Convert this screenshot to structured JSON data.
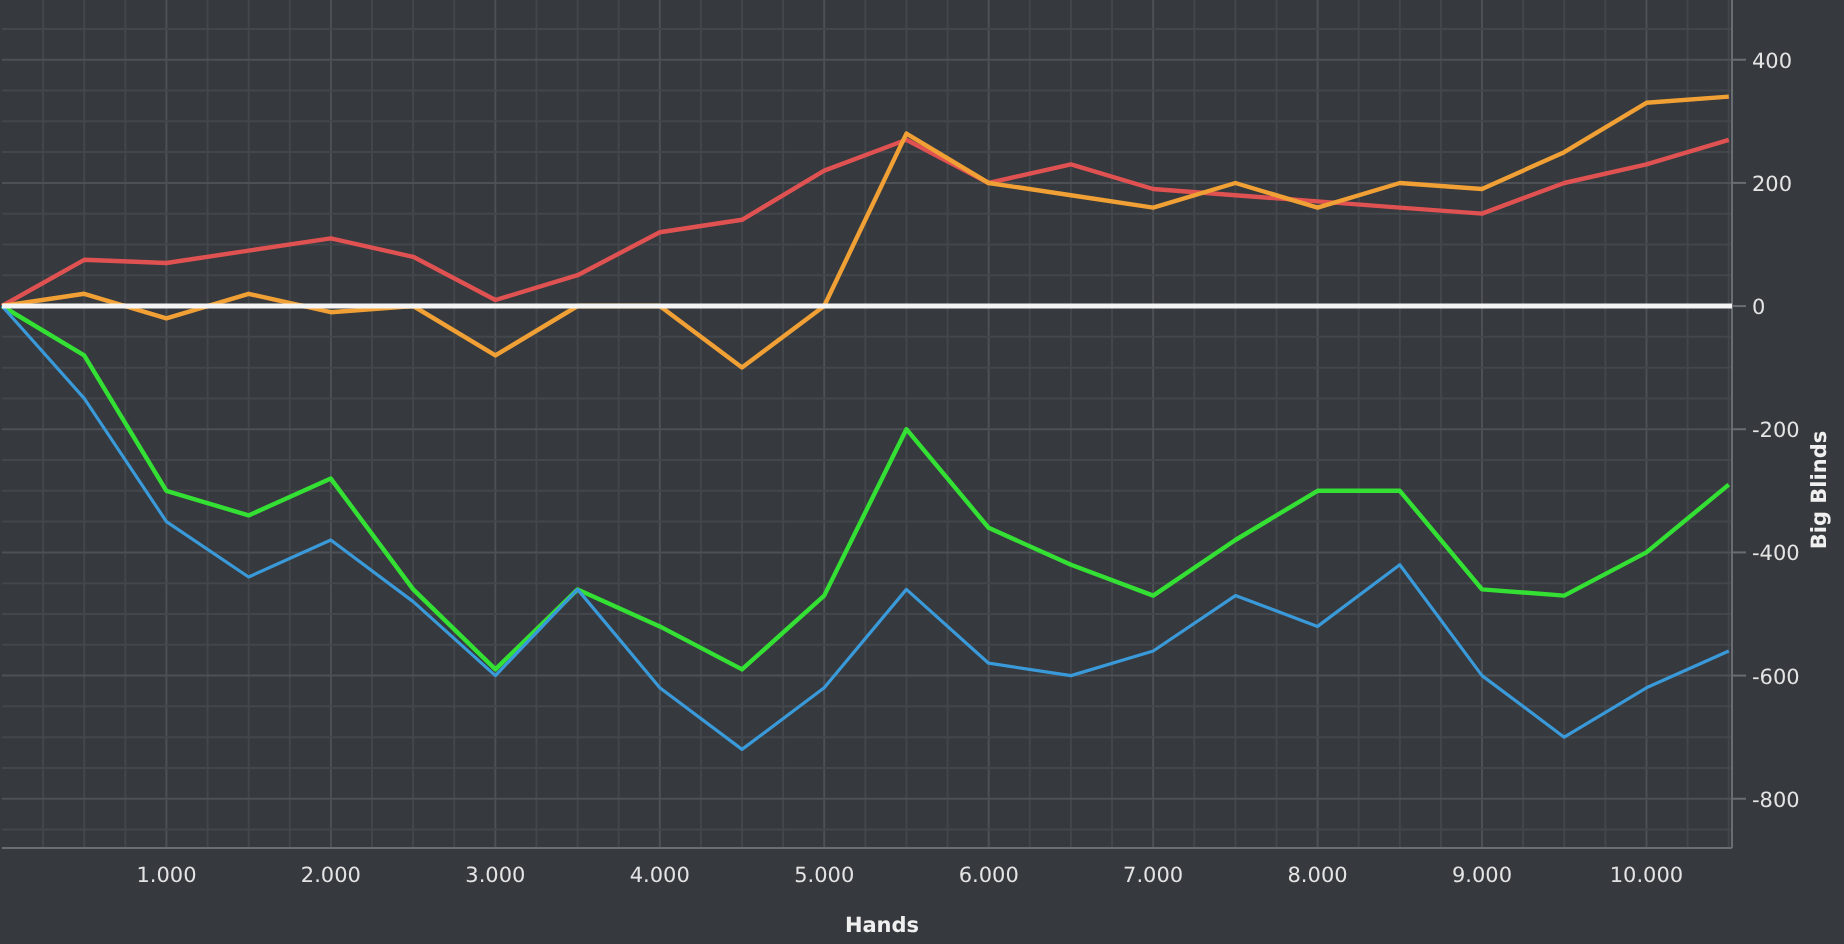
{
  "chart_data": {
    "type": "line",
    "grid": true,
    "xlabel": "Hands",
    "ylabel": "Big Blinds",
    "x": [
      0,
      500,
      1000,
      1500,
      2000,
      2500,
      3000,
      3500,
      4000,
      4500,
      5000,
      5500,
      6000,
      6500,
      7000,
      7500,
      8000,
      8500,
      9000,
      9500,
      10000,
      10500
    ],
    "series": [
      {
        "color": "#e05252",
        "values": [
          0,
          75,
          70,
          90,
          110,
          80,
          10,
          50,
          120,
          140,
          220,
          270,
          200,
          230,
          190,
          180,
          170,
          160,
          150,
          200,
          230,
          270
        ]
      },
      {
        "color": "#f0a035",
        "values": [
          0,
          20,
          -20,
          20,
          -10,
          0,
          -80,
          0,
          0,
          -100,
          0,
          280,
          200,
          180,
          160,
          200,
          160,
          200,
          190,
          250,
          330,
          340
        ]
      },
      {
        "color": "#33e033",
        "values": [
          0,
          -80,
          -300,
          -340,
          -280,
          -460,
          -590,
          -460,
          -520,
          -590,
          -470,
          -200,
          -360,
          -420,
          -470,
          -380,
          -300,
          -300,
          -460,
          -470,
          -400,
          -290
        ]
      },
      {
        "color": "#3a9ad9",
        "values": [
          0,
          -150,
          -350,
          -440,
          -380,
          -480,
          -600,
          -460,
          -620,
          -720,
          -620,
          -460,
          -580,
          -600,
          -560,
          -470,
          -520,
          -420,
          -600,
          -700,
          -620,
          -560
        ]
      }
    ],
    "xlim": [
      0,
      10520
    ],
    "ylim": [
      -880,
      497
    ],
    "xticks": [
      {
        "value": 1000,
        "label": "1.000"
      },
      {
        "value": 2000,
        "label": "2.000"
      },
      {
        "value": 3000,
        "label": "3.000"
      },
      {
        "value": 4000,
        "label": "4.000"
      },
      {
        "value": 5000,
        "label": "5.000"
      },
      {
        "value": 6000,
        "label": "6.000"
      },
      {
        "value": 7000,
        "label": "7.000"
      },
      {
        "value": 8000,
        "label": "8.000"
      },
      {
        "value": 9000,
        "label": "9.000"
      },
      {
        "value": 10000,
        "label": "10.000"
      }
    ],
    "yticks": [
      -800,
      -600,
      -400,
      -200,
      0,
      200,
      400
    ]
  }
}
